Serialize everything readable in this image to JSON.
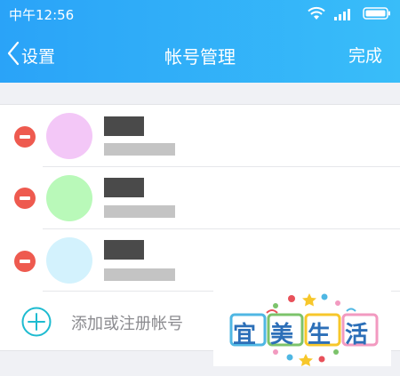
{
  "status_bar": {
    "time": "中午12:56",
    "icons": [
      "wifi-icon",
      "signal-icon",
      "battery-icon"
    ]
  },
  "nav": {
    "back_label": "设置",
    "title": "帐号管理",
    "done_label": "完成"
  },
  "accounts": [
    {
      "avatar_color": "#f3c7f7",
      "name": "",
      "id": ""
    },
    {
      "avatar_color": "#b9f9b9",
      "name": "",
      "id": ""
    },
    {
      "avatar_color": "#d3f2fd",
      "name": "",
      "id": ""
    }
  ],
  "add_account": {
    "label": "添加或注册帐号"
  },
  "watermark": {
    "text": "宜美生活"
  },
  "colors": {
    "header_start": "#2aa3f8",
    "header_end": "#39bdf9",
    "delete_red": "#ee5a4f",
    "add_teal": "#1dbbd0"
  }
}
